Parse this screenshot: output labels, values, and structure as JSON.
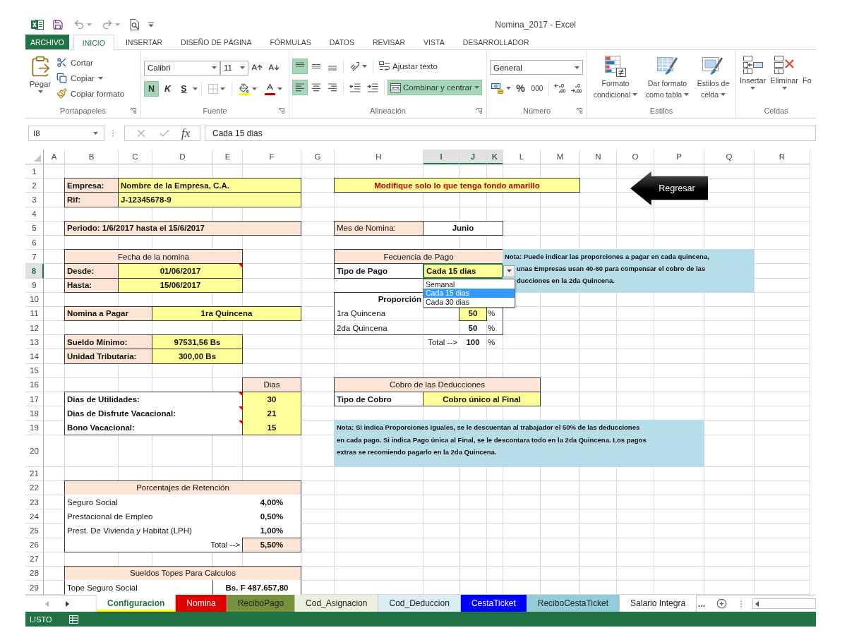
{
  "window": {
    "title": "Nomina_2017 - Excel"
  },
  "ribbon_tabs": [
    {
      "label": "ARCHIVO",
      "kind": "file",
      "selected": false
    },
    {
      "label": "INICIO",
      "kind": "tab",
      "selected": true
    },
    {
      "label": "INSERTAR",
      "kind": "tab",
      "selected": false
    },
    {
      "label": "DISEÑO DE PÁGINA",
      "kind": "tab",
      "selected": false
    },
    {
      "label": "FÓRMULAS",
      "kind": "tab",
      "selected": false
    },
    {
      "label": "DATOS",
      "kind": "tab",
      "selected": false
    },
    {
      "label": "REVISAR",
      "kind": "tab",
      "selected": false
    },
    {
      "label": "VISTA",
      "kind": "tab",
      "selected": false
    },
    {
      "label": "DESARROLLADOR",
      "kind": "tab",
      "selected": false
    }
  ],
  "ribbon": {
    "clipboard": {
      "label": "Portapapeles",
      "paste": "Pegar",
      "cut": "Cortar",
      "copy": "Copiar",
      "format_painter": "Copiar formato"
    },
    "font": {
      "label": "Fuente",
      "font_name": "Calibri",
      "font_size": "11",
      "toggles": [
        {
          "kind": "bold",
          "label": "N",
          "on": true
        },
        {
          "kind": "italic",
          "label": "K",
          "on": false
        },
        {
          "kind": "underline",
          "label": "S",
          "on": false
        }
      ]
    },
    "alignment": {
      "label": "Alineación",
      "vertical": [
        {
          "kind": "top",
          "on": true
        },
        {
          "kind": "middle",
          "on": false
        },
        {
          "kind": "bottom",
          "on": false
        }
      ],
      "horizontal": [
        {
          "kind": "left",
          "on": true
        },
        {
          "kind": "center",
          "on": false
        },
        {
          "kind": "right",
          "on": false
        }
      ],
      "wrap_text": {
        "label": "Ajustar texto",
        "on": false
      },
      "merge": {
        "label": "Combinar y centrar",
        "on": true
      }
    },
    "number": {
      "label": "Número",
      "format": "General",
      "percent": "%",
      "thousands": "000"
    },
    "styles": {
      "label": "Estilos",
      "buttons": [
        {
          "kind": "conditional",
          "lines": [
            "Formato",
            "condicional"
          ]
        },
        {
          "kind": "table",
          "lines": [
            "Dar formato",
            "como tabla"
          ]
        },
        {
          "kind": "cell_styles",
          "lines": [
            "Estilos de",
            "celda"
          ]
        }
      ]
    },
    "cells": {
      "label": "Celdas",
      "buttons": [
        {
          "kind": "insert",
          "label": "Insertar"
        },
        {
          "kind": "delete",
          "label": "Eliminar"
        },
        {
          "kind": "format",
          "label": "Fo"
        }
      ]
    }
  },
  "formula_bar": {
    "name_box": "I8",
    "insert_function": "fx",
    "formula": "Cada 15 dias"
  },
  "columns": [
    {
      "label": "A",
      "selected": false
    },
    {
      "label": "B",
      "selected": false
    },
    {
      "label": "C",
      "selected": false
    },
    {
      "label": "D",
      "selected": false
    },
    {
      "label": "E",
      "selected": false
    },
    {
      "label": "F",
      "selected": false
    },
    {
      "label": "G",
      "selected": false
    },
    {
      "label": "H",
      "selected": false
    },
    {
      "label": "I",
      "selected": true
    },
    {
      "label": "J",
      "selected": true
    },
    {
      "label": "K",
      "selected": true
    },
    {
      "label": "L",
      "selected": false
    },
    {
      "label": "M",
      "selected": false
    },
    {
      "label": "N",
      "selected": false
    },
    {
      "label": "O",
      "selected": false
    },
    {
      "label": "P",
      "selected": false
    },
    {
      "label": "Q",
      "selected": false
    },
    {
      "label": "R",
      "selected": false
    }
  ],
  "rows": [
    {
      "label": "1",
      "selected": false
    },
    {
      "label": "2",
      "selected": false
    },
    {
      "label": "3",
      "selected": false
    },
    {
      "label": "4",
      "selected": false
    },
    {
      "label": "5",
      "selected": false
    },
    {
      "label": "6",
      "selected": false
    },
    {
      "label": "7",
      "selected": false
    },
    {
      "label": "8",
      "selected": true
    },
    {
      "label": "9",
      "selected": false
    },
    {
      "label": "10",
      "selected": false
    },
    {
      "label": "11",
      "selected": false
    },
    {
      "label": "12",
      "selected": false
    },
    {
      "label": "13",
      "selected": false
    },
    {
      "label": "14",
      "selected": false
    },
    {
      "label": "15",
      "selected": false
    },
    {
      "label": "16",
      "selected": false
    },
    {
      "label": "17",
      "selected": false
    },
    {
      "label": "18",
      "selected": false
    },
    {
      "label": "19",
      "selected": false
    },
    {
      "label": "20",
      "selected": false
    },
    {
      "label": "21",
      "selected": false
    },
    {
      "label": "22",
      "selected": false
    },
    {
      "label": "23",
      "selected": false
    },
    {
      "label": "24",
      "selected": false
    },
    {
      "label": "25",
      "selected": false
    },
    {
      "label": "26",
      "selected": false
    },
    {
      "label": "27",
      "selected": false
    },
    {
      "label": "28",
      "selected": false
    },
    {
      "label": "29",
      "selected": false
    }
  ],
  "sheet": {
    "company": [
      {
        "label": "Empresa:",
        "value": "Nombre de la Empresa, C.A."
      },
      {
        "label": "Rif:",
        "value": "J-12345678-9"
      }
    ],
    "instruction": "Modifique solo lo que tenga fondo amarillo",
    "back_button": "Regresar",
    "period": "Periodo: 1/6/2017 hasta el 15/6/2017",
    "payroll_month": {
      "label": "Mes de Nomina:",
      "value": "Junio"
    },
    "payroll_dates": {
      "title": "Fecha de la nomina",
      "rows": [
        {
          "label": "Desde:",
          "value": "01/06/2017",
          "comment": true
        },
        {
          "label": "Hasta:",
          "value": "15/06/2017",
          "comment": false
        }
      ]
    },
    "payment_frequency": {
      "title": "Fecuencia de Pago",
      "label": "Tipo de Pago",
      "value": "Cada 15 dias",
      "selected": true,
      "expanded": true,
      "options": [
        {
          "label": "Semanal",
          "selected": false
        },
        {
          "label": "Cada 15 dias",
          "selected": true
        },
        {
          "label": "Cada 30 dias",
          "selected": false
        }
      ]
    },
    "frequency_note": {
      "lines": [
        "Nota: Puede indicar las proporciones a pagar en cada quincena,",
        "unas Empresas usan 40-60 para compensar el cobro de las",
        "ducciones en la 2da Quincena."
      ]
    },
    "payroll_to_pay": {
      "label": "Nomina a Pagar",
      "value": "1ra Quincena"
    },
    "proportions": {
      "title": "Proporción",
      "rows": [
        {
          "label": "1ra Quincena",
          "value": "50",
          "unit": "%",
          "highlighted": true
        },
        {
          "label": "2da Quincena",
          "value": "50",
          "unit": "%",
          "highlighted": false
        }
      ],
      "total_label": "Total -->",
      "total": "100",
      "total_unit": "%"
    },
    "base_amounts": [
      {
        "label": "Sueldo Mínimo:",
        "value": "97531,56 Bs"
      },
      {
        "label": "Unidad Tributaria:",
        "value": "300,00 Bs"
      }
    ],
    "days": {
      "header": "Dias",
      "rows": [
        {
          "label": "Dias de Utilidades:",
          "value": "30",
          "comment": true
        },
        {
          "label": "Dias de Disfrute Vacacional:",
          "value": "21",
          "comment": true
        },
        {
          "label": "Bono Vacacional:",
          "value": "15",
          "comment": true
        }
      ]
    },
    "deductions": {
      "title": "Cobro de las Deducciones",
      "label": "Tipo de Cobro",
      "value": "Cobro único al Final"
    },
    "deductions_note": {
      "lines": [
        "Nota: Si indica Proporciones Iguales, se le descuentan al trabajador el 50% de las deducciones",
        "en cada pago. Si indica Pago única al Final, se le descontara todo en la 2da Quincena. Los pagos",
        "extras se recomiendo pagarlo en la 2da Quincena."
      ]
    },
    "retention": {
      "title": "Porcentajes de Retención",
      "rows": [
        {
          "label": "Seguro Social",
          "value": "4,00%"
        },
        {
          "label": "Prestacional de Empleo",
          "value": "0,50%"
        },
        {
          "label": "Prest. De Vivienda y Habitat (LPH)",
          "value": "1,00%"
        }
      ],
      "total_label": "Total -->",
      "total": "5,50%"
    },
    "salary_caps": {
      "title": "Sueldos Topes Para Calculos",
      "rows": [
        {
          "label": "Tope Seguro Social",
          "value": "Bs. F 487.657,80"
        }
      ]
    }
  },
  "sheet_tabs": [
    {
      "label": "Configuracion",
      "color": "#ffff00",
      "selected": true
    },
    {
      "label": "Nomina",
      "color": "#e00000",
      "selected": false
    },
    {
      "label": "ReciboPago",
      "color": "#76923c",
      "selected": false
    },
    {
      "label": "Cod_Asignacion",
      "color": "#ebf1de",
      "selected": false
    },
    {
      "label": "Cod_Deduccion",
      "color": "#daeef3",
      "selected": false
    },
    {
      "label": "CestaTicket",
      "color": "#0000ff",
      "selected": false
    },
    {
      "label": "ReciboCestaTicket",
      "color": "#92cddc",
      "selected": false
    },
    {
      "label": "Salario Integra",
      "selected": false
    }
  ],
  "more_tabs": "...",
  "status_bar": {
    "text": "LISTO"
  }
}
